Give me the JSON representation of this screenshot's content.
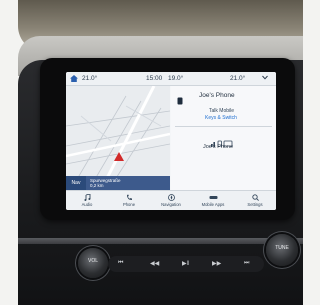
{
  "status_bar": {
    "outside_temp": "21.0°",
    "time": "15:00",
    "cabin_temp": "19.0°",
    "right_temp": "21.0°"
  },
  "navigation": {
    "badge_label": "Nav",
    "info_line1": "Spurwegstraße",
    "info_line2": "0,2 km"
  },
  "phone": {
    "title": "Joe's Phone",
    "subtitle": "Talk Mobile",
    "link": "Keys & Switch",
    "status_name": "Joe's Phone"
  },
  "bottom_nav": {
    "items": [
      {
        "label": "Audio",
        "icon": "music-note-icon"
      },
      {
        "label": "Phone",
        "icon": "phone-icon"
      },
      {
        "label": "Navigation",
        "icon": "compass-icon"
      },
      {
        "label": "Mobile Apps",
        "icon": "apps-icon"
      },
      {
        "label": "Settings",
        "icon": "search-icon"
      }
    ]
  },
  "controls": {
    "left_knob_label": "VOL",
    "right_knob_label": "TUNE"
  },
  "colors": {
    "screen_bg": "#f4f6f8",
    "accent_blue": "#1f6fd1",
    "map_info_bg": "#3d5a8c",
    "alert_red": "#d12a2a"
  }
}
